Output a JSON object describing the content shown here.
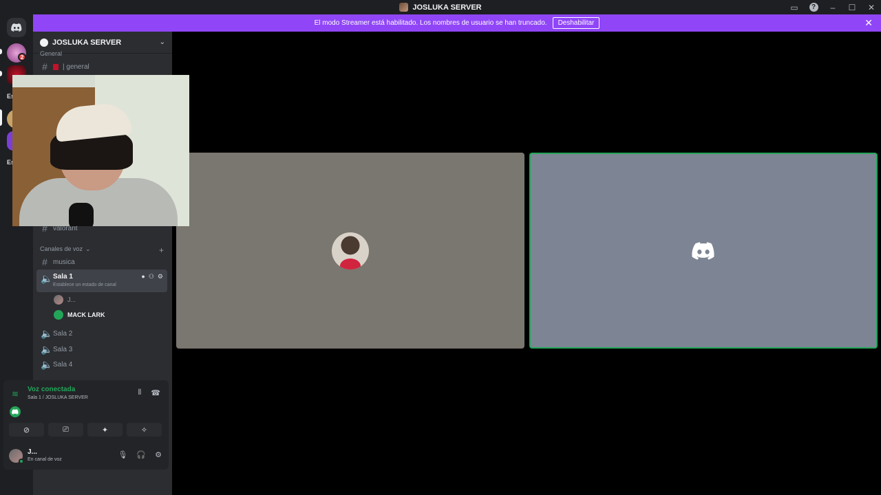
{
  "window": {
    "title": "JOSLUKA SERVER"
  },
  "banner": {
    "text": "El modo Streamer está habilitado. Los nombres de usuario se han truncado.",
    "button": "Deshabilitar"
  },
  "rail": {
    "badge": "2",
    "label1": "Es",
    "label2": "Es"
  },
  "server": {
    "name": "JOSLUKA SERVER"
  },
  "categories": {
    "general": "General",
    "voice": "Canales de voz"
  },
  "channels": {
    "general": "| general",
    "valorant": "valorant",
    "musica": "musica",
    "sala1": "Sala 1",
    "sala1_sub": "Establece un estado de canal",
    "sala2": "Sala 2",
    "sala3": "Sala 3",
    "sala4": "Sala 4"
  },
  "members": [
    {
      "name": "J..."
    },
    {
      "name": "MACK LARK"
    }
  ],
  "voice": {
    "status": "Voz conectada",
    "location": "Sala 1 / JOSLUKA SERVER"
  },
  "user": {
    "name": "J...",
    "status": "En canal de voz"
  },
  "icons": {
    "discord": "discord-icon",
    "hash": "hash-icon",
    "speaker": "speaker-icon"
  },
  "colors": {
    "banner": "#9046f7",
    "online": "#23a559",
    "sidebar": "#2b2d31"
  }
}
